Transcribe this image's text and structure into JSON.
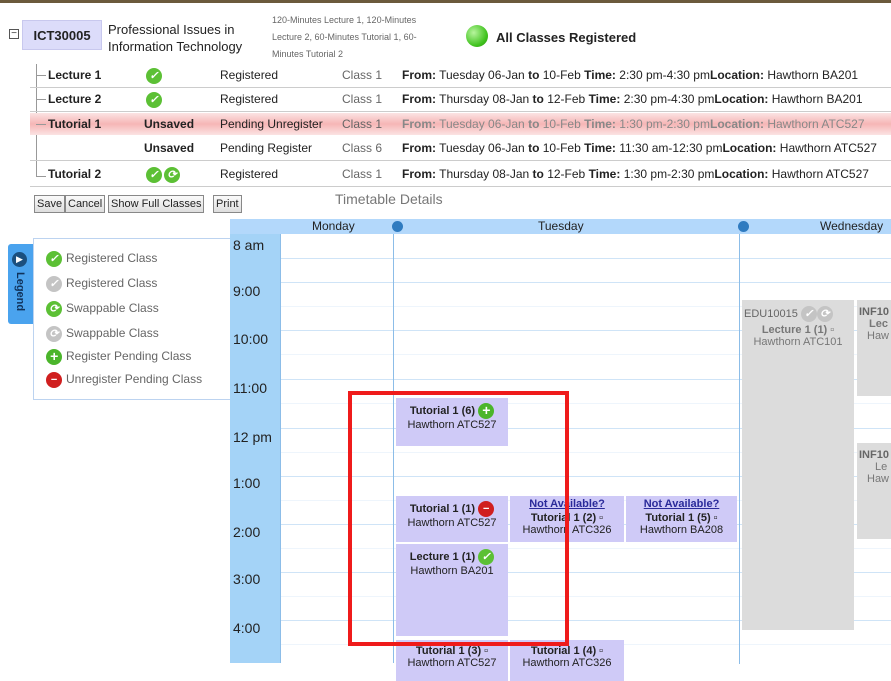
{
  "course": {
    "code": "ICT30005",
    "title_line1": "Professional Issues in",
    "title_line2": "Information Technology",
    "hours_line1": "120-Minutes Lecture 1, 120-Minutes",
    "hours_line2": "Lecture 2, 60-Minutes Tutorial 1, 60-",
    "hours_line3": "Minutes Tutorial 2",
    "status": "All Classes Registered",
    "expander": "−"
  },
  "rows": [
    {
      "name": "Lecture 1",
      "status": "Registered",
      "class": "Class 1",
      "from": "From:",
      "from_val": "Tuesday 06-Jan",
      "to": "to",
      "to_val": "10-Feb",
      "time": "Time:",
      "time_val": "2:30 pm-4:30 pm",
      "loc": "Location:",
      "loc_val": "Hawthorn BA201"
    },
    {
      "name": "Lecture 2",
      "status": "Registered",
      "class": "Class 1",
      "from": "From:",
      "from_val": "Thursday 08-Jan",
      "to": "to",
      "to_val": "12-Feb",
      "time": "Time:",
      "time_val": "2:30 pm-4:30 pm",
      "loc": "Location:",
      "loc_val": "Hawthorn BA201"
    },
    {
      "name": "Tutorial 1",
      "flag": "Unsaved",
      "status": "Pending Unregister",
      "class": "Class 1",
      "from": "From:",
      "from_val": "Tuesday 06-Jan",
      "to": "to",
      "to_val": "10-Feb",
      "time": "Time:",
      "time_val": "1:30 pm-2:30 pm",
      "loc": "Location:",
      "loc_val": "Hawthorn ATC527"
    },
    {
      "name": "",
      "flag": "Unsaved",
      "status": "Pending Register",
      "class": "Class 6",
      "from": "From:",
      "from_val": "Tuesday 06-Jan",
      "to": "to",
      "to_val": "10-Feb",
      "time": "Time:",
      "time_val": "11:30 am-12:30 pm",
      "loc": "Location:",
      "loc_val": "Hawthorn ATC527"
    },
    {
      "name": "Tutorial 2",
      "status": "Registered",
      "class": "Class 1",
      "from": "From:",
      "from_val": "Thursday 08-Jan",
      "to": "to",
      "to_val": "12-Feb",
      "time": "Time:",
      "time_val": "1:30 pm-2:30 pm",
      "loc": "Location:",
      "loc_val": "Hawthorn ATC527"
    }
  ],
  "toolbar": {
    "save": "Save",
    "cancel": "Cancel",
    "show_full": "Show Full Classes",
    "print": "Print"
  },
  "timetable_title": "Timetable Details",
  "legend": {
    "tab": "Legend",
    "items": [
      {
        "label": "Registered Class",
        "icon": "check-green-icon"
      },
      {
        "label": "Registered Class",
        "icon": "check-grey-icon"
      },
      {
        "label": "Swappable Class",
        "icon": "swap-green-icon"
      },
      {
        "label": "Swappable Class",
        "icon": "swap-grey-icon"
      },
      {
        "label": "Register Pending Class",
        "icon": "plus-green-icon"
      },
      {
        "label": "Unregister Pending Class",
        "icon": "minus-red-icon"
      }
    ]
  },
  "calendar": {
    "days": [
      "Monday",
      "Tuesday",
      "Wednesday"
    ],
    "times": [
      "8 am",
      "9:00",
      "10:00",
      "11:00",
      "12 pm",
      "1:00",
      "2:00",
      "3:00",
      "4:00"
    ],
    "events": {
      "tut6_title": "Tutorial 1 (6)",
      "tut6_loc": "Hawthorn ATC527",
      "tut1_title": "Tutorial 1 (1)",
      "tut1_loc": "Hawthorn ATC527",
      "na1": "Not Available?",
      "tut2_title": "Tutorial 1 (2) ▫",
      "tut2_loc": "Hawthorn ATC326",
      "na2": "Not Available?",
      "tut5_title": "Tutorial 1 (5) ▫",
      "tut5_loc": "Hawthorn BA208",
      "lec1_title": "Lecture 1 (1)",
      "lec1_loc": "Hawthorn BA201",
      "tut3_title": "Tutorial 1 (3) ▫",
      "tut3_loc": "Hawthorn ATC527",
      "tut4_title": "Tutorial 1 (4) ▫",
      "tut4_loc": "Hawthorn ATC326",
      "edu_code": "EDU10015",
      "edu_title": "Lecture 1 (1) ▫",
      "edu_loc": "Hawthorn ATC101",
      "inf1_code": "INF10",
      "inf1_title": "Lec",
      "inf1_loc": "Haw",
      "inf2_code": "INF10",
      "inf2_title": "Le",
      "inf2_loc": "Haw"
    }
  },
  "colors": {
    "event": "#cfcaf7",
    "registered": "#5cc035",
    "pending_unregister": "#f6b6b6",
    "highlight": "#ef1b1b"
  }
}
